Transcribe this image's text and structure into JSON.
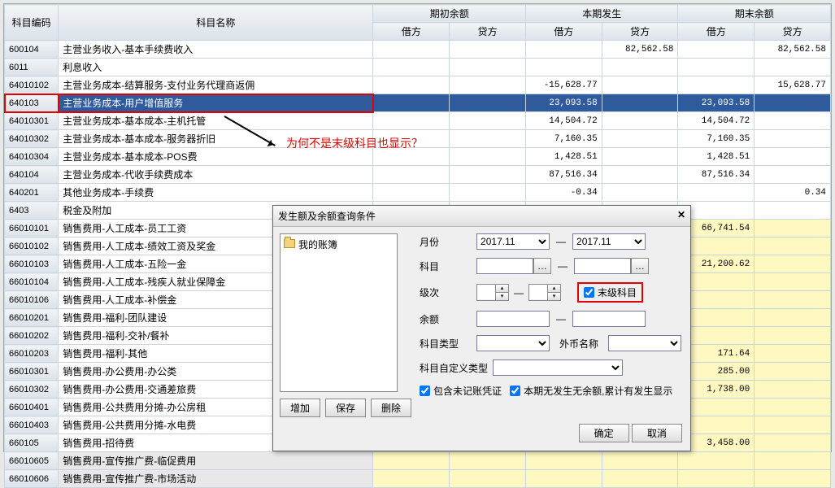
{
  "headers": {
    "code": "科目编码",
    "name": "科目名称",
    "g1": "期初余额",
    "g2": "本期发生",
    "g3": "期末余额",
    "debit": "借方",
    "credit": "贷方"
  },
  "rows": [
    {
      "code": "600104",
      "name": "  主营业务收入-基本手续费收入",
      "c4": "82,562.58",
      "c6": "82,562.58"
    },
    {
      "code": "6011",
      "name": "利息收入"
    },
    {
      "code": "64010102",
      "name": "    主营业务成本-结算服务-支付业务代理商返佣",
      "c3": "-15,628.77",
      "c6": "15,628.77"
    },
    {
      "code": "640103",
      "name": "  主营业务成本-用户增值服务",
      "c3": "23,093.58",
      "c5": "23,093.58",
      "sel": true,
      "redbox": true
    },
    {
      "code": "64010301",
      "name": "    主营业务成本-基本成本-主机托管",
      "c3": "14,504.72",
      "c5": "14,504.72"
    },
    {
      "code": "64010302",
      "name": "    主营业务成本-基本成本-服务器折旧",
      "c3": "7,160.35",
      "c5": "7,160.35"
    },
    {
      "code": "64010304",
      "name": "    主营业务成本-基本成本-POS费",
      "c3": "1,428.51",
      "c5": "1,428.51"
    },
    {
      "code": "640104",
      "name": "  主营业务成本-代收手续费成本",
      "c3": "87,516.34",
      "c5": "87,516.34"
    },
    {
      "code": "640201",
      "name": "  其他业务成本-手续费",
      "c3": "-0.34",
      "c6": "0.34"
    },
    {
      "code": "6403",
      "name": "税金及附加"
    },
    {
      "code": "66010101",
      "name": "    销售费用-人工成本-员工工资",
      "c5": "66,741.54",
      "yel": true
    },
    {
      "code": "66010102",
      "name": "    销售费用-人工成本-绩效工资及奖金",
      "yel": true
    },
    {
      "code": "66010103",
      "name": "    销售费用-人工成本-五险一金",
      "c5": "21,200.62",
      "yel": true
    },
    {
      "code": "66010104",
      "name": "    销售费用-人工成本-残疾人就业保障金",
      "yel": true
    },
    {
      "code": "66010106",
      "name": "    销售费用-人工成本-补偿金",
      "yel": true
    },
    {
      "code": "66010201",
      "name": "    销售费用-福利-团队建设",
      "yel": true
    },
    {
      "code": "66010202",
      "name": "    销售费用-福利-交补/餐补",
      "yel": true
    },
    {
      "code": "66010203",
      "name": "    销售费用-福利-其他",
      "c5": "171.64",
      "yel": true
    },
    {
      "code": "66010301",
      "name": "    销售费用-办公费用-办公类",
      "c5": "285.00",
      "yel": true
    },
    {
      "code": "66010302",
      "name": "    销售费用-办公费用-交通差旅费",
      "c5": "1,738.00",
      "yel": true
    },
    {
      "code": "66010401",
      "name": "    销售费用-公共费用分摊-办公房租",
      "yel": true
    },
    {
      "code": "66010403",
      "name": "    销售费用-公共费用分摊-水电费",
      "yel": true
    },
    {
      "code": "660105",
      "name": "  销售费用-招待费",
      "c5": "3,458.00",
      "yel": true
    },
    {
      "code": "66010605",
      "name": "    销售费用-宣传推广费-临促费用",
      "yel": true
    },
    {
      "code": "66010606",
      "name": "    销售费用-宣传推广费-市场活动",
      "yel": true
    }
  ],
  "annotation": "为何不是末级科目也显示？",
  "dialog": {
    "title": "发生额及余额查询条件",
    "tree_root": "我的账簿",
    "labels": {
      "month": "月份",
      "subject": "科目",
      "level": "级次",
      "leaf": "末级科目",
      "balance": "余额",
      "subj_type": "科目类型",
      "currency": "外币名称",
      "custom": "科目自定义类型"
    },
    "month_from": "2017.11",
    "month_to": "2017.11",
    "btns": {
      "add": "增加",
      "save": "保存",
      "del": "删除",
      "ok": "确定",
      "cancel": "取消"
    },
    "checks": {
      "incl": "包含未记账凭证",
      "nochg": "本期无发生无余额,累计有发生显示"
    }
  }
}
